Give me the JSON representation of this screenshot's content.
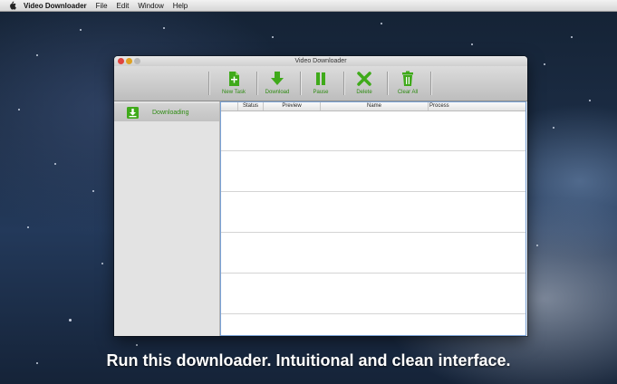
{
  "menubar": {
    "app_name": "Video Downloader",
    "items": [
      "File",
      "Edit",
      "Window",
      "Help"
    ]
  },
  "window": {
    "title": "Video Downloader"
  },
  "toolbar": {
    "buttons": [
      {
        "label": "New Task",
        "icon": "new-task-icon"
      },
      {
        "label": "Download",
        "icon": "download-arrow-icon"
      },
      {
        "label": "Pause",
        "icon": "pause-icon"
      },
      {
        "label": "Delete",
        "icon": "delete-x-icon"
      },
      {
        "label": "Clear All",
        "icon": "trash-icon"
      }
    ]
  },
  "sidebar": {
    "items": [
      {
        "label": "Downloading",
        "icon": "download-tray-icon"
      }
    ]
  },
  "table": {
    "columns": [
      "Status",
      "Preview",
      "Name",
      "Process"
    ]
  },
  "caption": "Run this downloader. Intuitional and clean interface.",
  "colors": {
    "accent_green": "#2e8b12",
    "icon_green": "#3faa1a",
    "selection_border": "#7aa2d6"
  }
}
